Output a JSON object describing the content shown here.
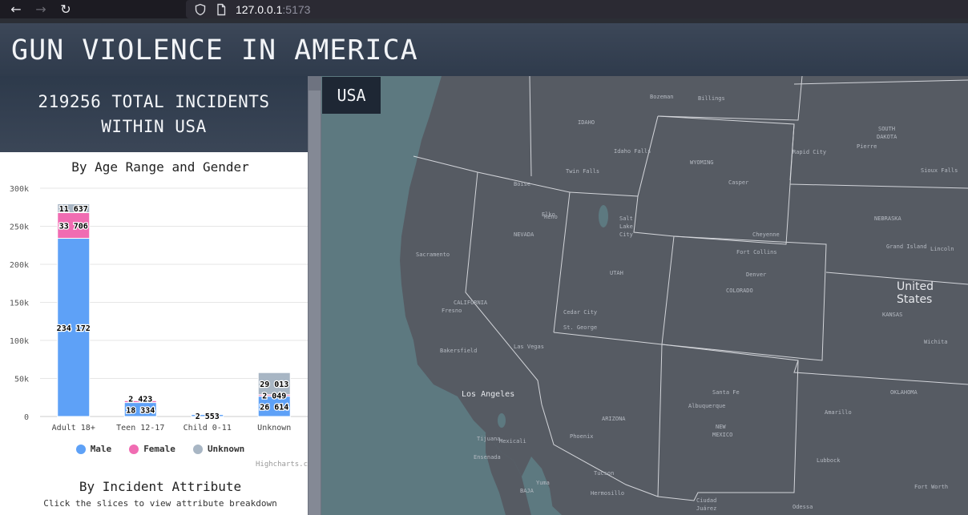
{
  "browser": {
    "url_host": "127.0.0.1",
    "url_port": ":5173",
    "back_icon": "arrow-left",
    "forward_icon": "arrow-right",
    "reload_icon": "reload"
  },
  "header": {
    "title": "GUN VIOLENCE IN AMERICA"
  },
  "summary": {
    "total_text": "219256 TOTAL INCIDENTS\nWITHIN USA"
  },
  "colors": {
    "male": "#5ea1f7",
    "female": "#f06cb2",
    "unknown": "#a8b6c4"
  },
  "chart_data": {
    "type": "bar",
    "stacked": true,
    "title": "By Age Range and Gender",
    "categories": [
      "Adult 18+",
      "Teen 12-17",
      "Child 0-11",
      "Unknown"
    ],
    "series": [
      {
        "name": "Male",
        "values": [
          234172,
          18334,
          2553,
          26614
        ],
        "labels": [
          "234 172",
          "18 334",
          "2 553",
          "26 614"
        ]
      },
      {
        "name": "Female",
        "values": [
          33706,
          2423,
          0,
          2049
        ],
        "labels": [
          "33 706",
          "2 423",
          "",
          "2 049"
        ]
      },
      {
        "name": "Unknown",
        "values": [
          11637,
          0,
          0,
          29013
        ],
        "labels": [
          "11 637",
          "",
          "",
          "29 013"
        ]
      }
    ],
    "y_ticks": [
      "0",
      "50k",
      "100k",
      "150k",
      "200k",
      "250k",
      "300k"
    ],
    "ylim": [
      0,
      300000
    ],
    "grid": true,
    "legend_position": "bottom"
  },
  "legend": {
    "male": "Male",
    "female": "Female",
    "unknown": "Unknown"
  },
  "credits": "Highcharts.c",
  "attribute_section": {
    "title": "By Incident Attribute",
    "subtitle": "Click the slices to view attribute breakdown"
  },
  "map": {
    "badge": "USA",
    "labels": [
      "United",
      "States",
      "WYOMING",
      "IDAHO",
      "NEVADA",
      "UTAH",
      "COLORADO",
      "ARIZONA",
      "NEW",
      "MEXICO",
      "CALIFORNIA",
      "KANSAS",
      "NEBRASKA",
      "SOUTH",
      "DAKOTA",
      "OKLAHOMA",
      "BAJA",
      "Los Angeles",
      "Las Vegas",
      "Denver",
      "Phoenix",
      "Albuquerque",
      "Santa Fe",
      "Salt",
      "Lake",
      "City",
      "Fort Collins",
      "Cheyenne",
      "Casper",
      "Reno",
      "Fresno",
      "Bakersfield",
      "Sacramento",
      "Tucson",
      "Tijuana",
      "Mexicali",
      "Ensenada",
      "Ciudad",
      "Juárez",
      "Amarillo",
      "Lubbock",
      "Wichita",
      "Lincoln",
      "Grand Island",
      "Sioux Falls",
      "Pierre",
      "Rapid City",
      "Billings",
      "Bozeman",
      "Idaho Falls",
      "Twin Falls",
      "Boise",
      "Elko",
      "Cedar City",
      "St. George",
      "Fort Worth",
      "Odessa",
      "Yuma",
      "Hermosillo"
    ]
  }
}
